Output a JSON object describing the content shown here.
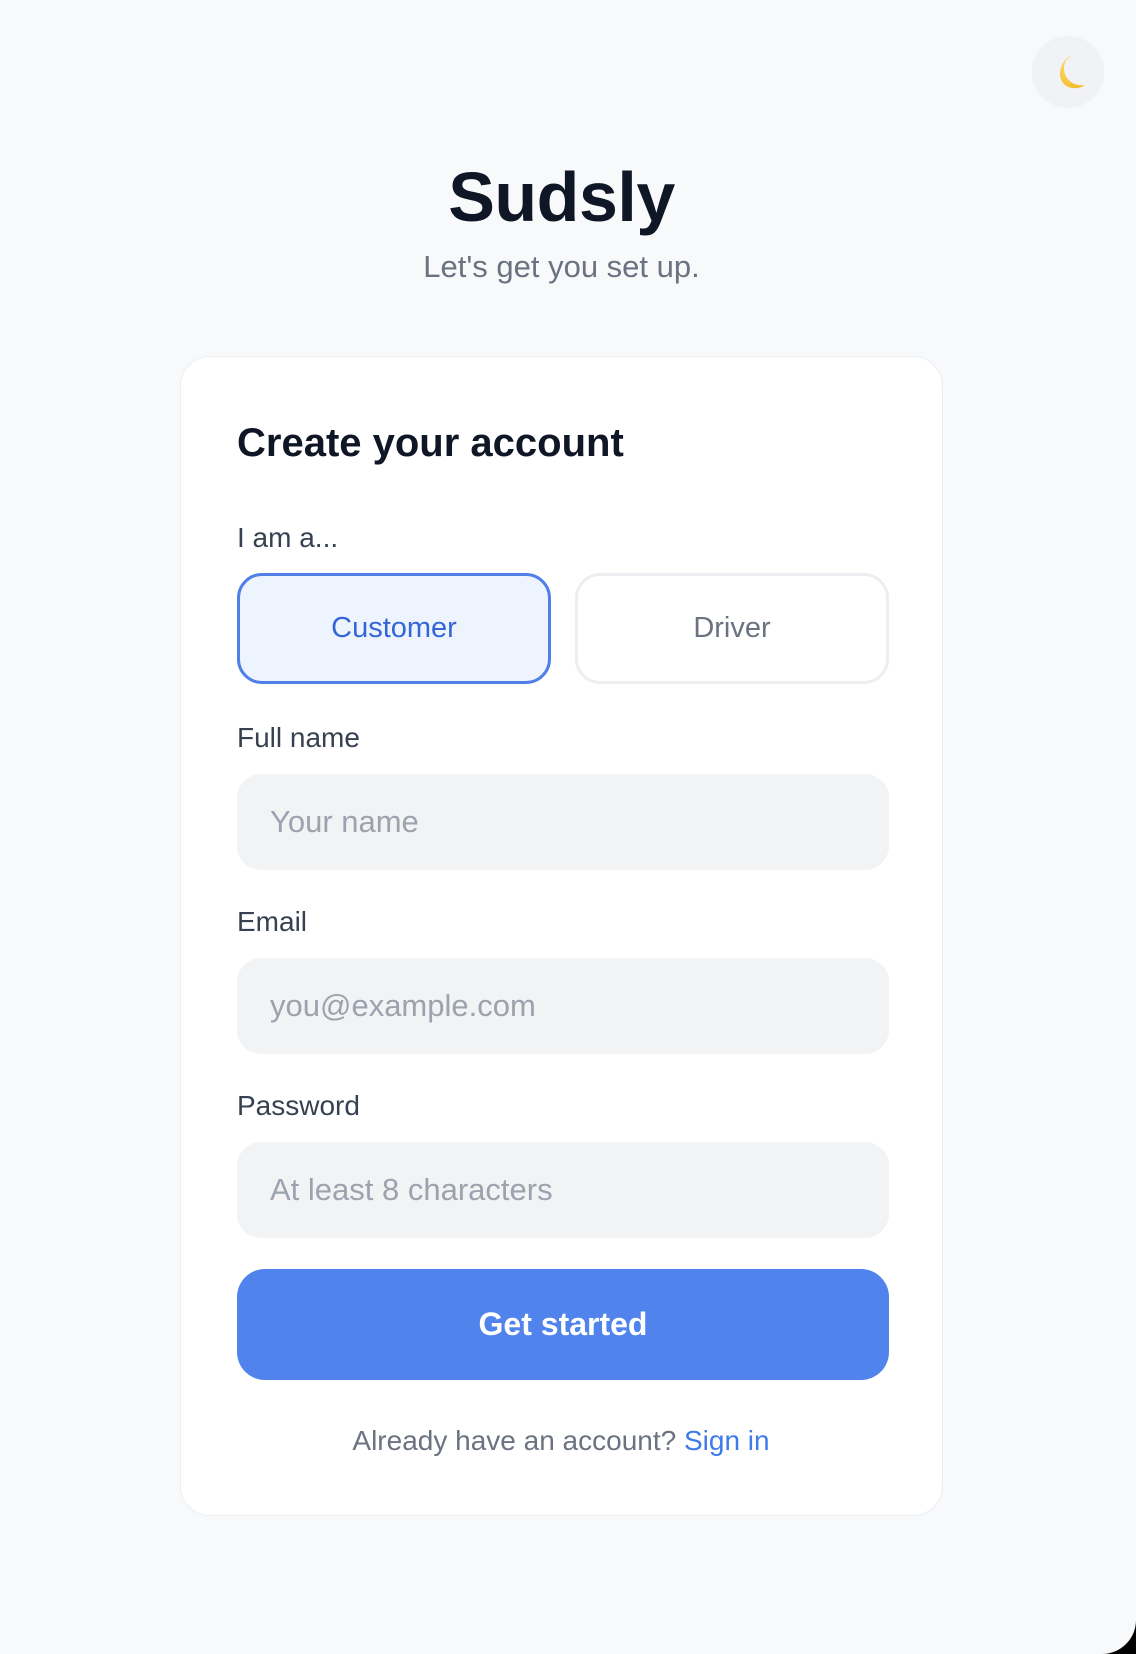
{
  "theme_toggle": {
    "icon": "crescent-moon-icon",
    "glyph": "🌙"
  },
  "header": {
    "brand": "Sudsly",
    "tagline": "Let's get you set up."
  },
  "form": {
    "title": "Create your account",
    "role": {
      "label": "I am a...",
      "options": [
        "Customer",
        "Driver"
      ],
      "selected": "Customer"
    },
    "full_name": {
      "label": "Full name",
      "placeholder": "Your name",
      "value": ""
    },
    "email": {
      "label": "Email",
      "placeholder": "you@example.com",
      "value": ""
    },
    "password": {
      "label": "Password",
      "placeholder": "At least 8 characters",
      "value": ""
    },
    "submit_label": "Get started",
    "footer": {
      "prompt": "Already have an account?",
      "link": "Sign in"
    }
  },
  "colors": {
    "accent": "#5083ec",
    "link": "#3f7be8",
    "selected_bg": "#edf4fe",
    "page_bg": "#f8f9fb"
  }
}
